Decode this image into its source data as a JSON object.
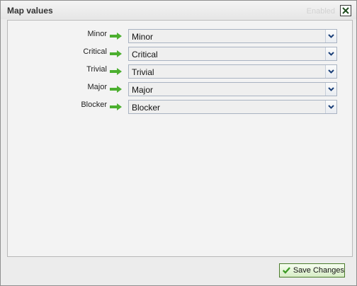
{
  "dialog": {
    "title": "Map values",
    "status_text": "Enabled",
    "close_icon": "close-icon"
  },
  "mappings": [
    {
      "source": "Minor",
      "target": "Minor"
    },
    {
      "source": "Critical",
      "target": "Critical"
    },
    {
      "source": "Trivial",
      "target": "Trivial"
    },
    {
      "source": "Major",
      "target": "Major"
    },
    {
      "source": "Blocker",
      "target": "Blocker"
    }
  ],
  "footer": {
    "save_label": "Save Changes",
    "save_icon": "checkmark-icon"
  },
  "colors": {
    "arrow": "#4caf2f",
    "select_border": "#a9b3c2",
    "save_border": "#4a7a2c"
  }
}
